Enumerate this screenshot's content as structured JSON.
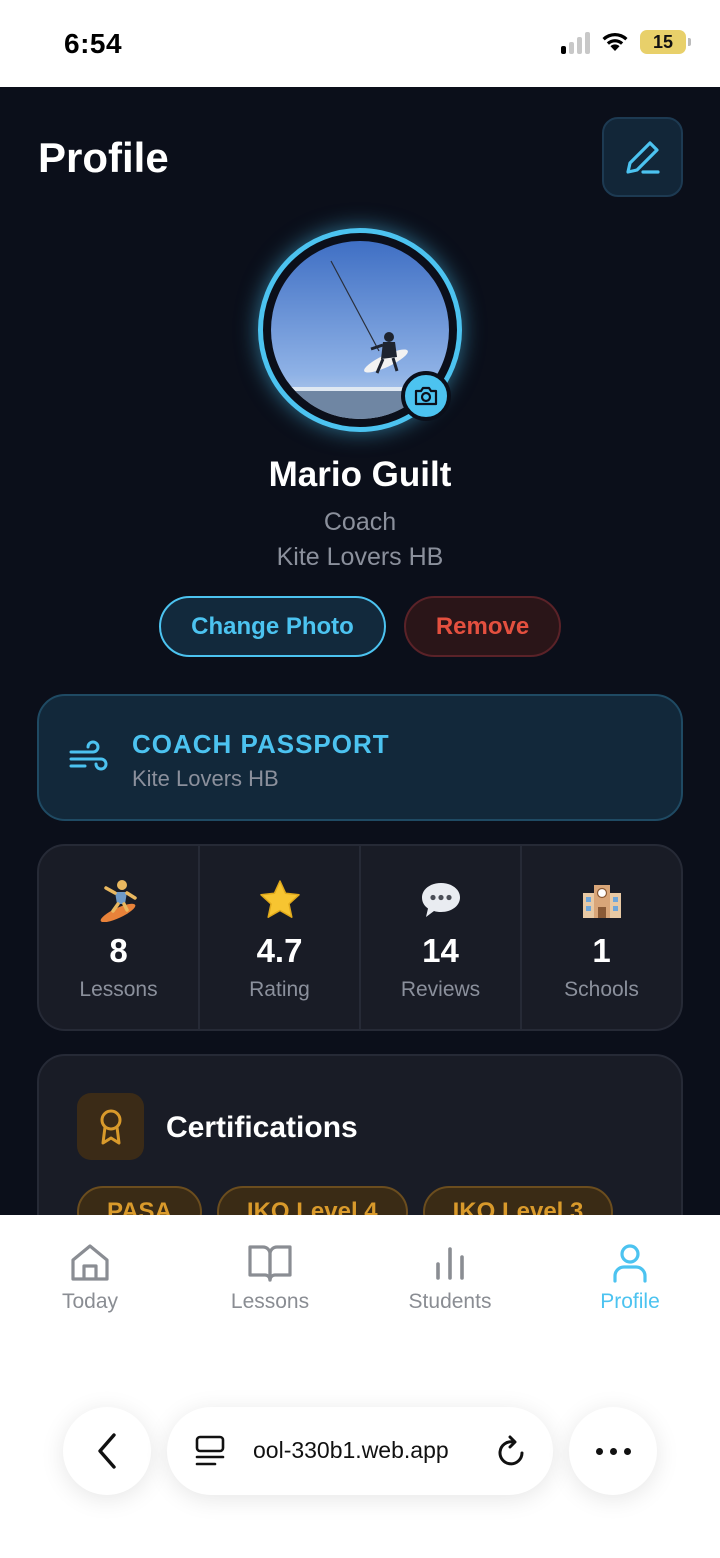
{
  "status_bar": {
    "time": "6:54",
    "battery": "15"
  },
  "header": {
    "title": "Profile"
  },
  "profile": {
    "name": "Mario Guilt",
    "role": "Coach",
    "school": "Kite Lovers HB",
    "change_photo_label": "Change Photo",
    "remove_label": "Remove"
  },
  "passport": {
    "title": "COACH PASSPORT",
    "subtitle": "Kite Lovers HB"
  },
  "stats": [
    {
      "icon": "surfer-emoji",
      "value": "8",
      "label": "Lessons"
    },
    {
      "icon": "star-emoji",
      "value": "4.7",
      "label": "Rating"
    },
    {
      "icon": "speech-bubble-emoji",
      "value": "14",
      "label": "Reviews"
    },
    {
      "icon": "school-building-emoji",
      "value": "1",
      "label": "Schools"
    }
  ],
  "certifications": {
    "title": "Certifications",
    "chips": [
      "PASA",
      "IKO Level 4",
      "IKO Level 3"
    ]
  },
  "nav": [
    {
      "icon": "home-icon",
      "label": "Today"
    },
    {
      "icon": "book-icon",
      "label": "Lessons"
    },
    {
      "icon": "bar-chart-icon",
      "label": "Students"
    },
    {
      "icon": "user-icon",
      "label": "Profile",
      "active": true
    }
  ],
  "browser": {
    "url": "ool-330b1.web.app"
  },
  "colors": {
    "accent": "#4cc3f0",
    "danger": "#e4503f",
    "gold": "#d99a2b",
    "background": "#0b0f1a"
  }
}
